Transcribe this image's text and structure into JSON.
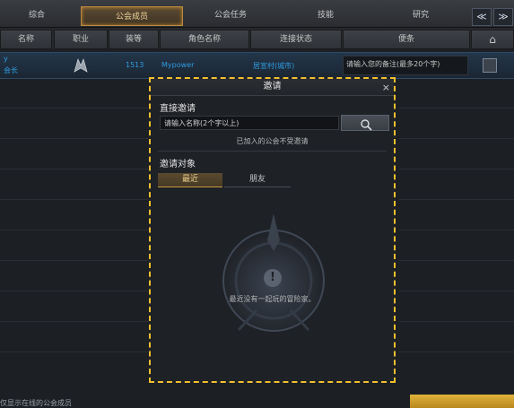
{
  "tabs": [
    {
      "label": "综合"
    },
    {
      "label": "公会成员",
      "active": true
    },
    {
      "label": "公会任务"
    },
    {
      "label": "技能"
    },
    {
      "label": "研究"
    }
  ],
  "nav": {
    "prev": "≪",
    "next": "≫"
  },
  "columns": [
    "名称",
    "职业",
    "装等",
    "角色名称",
    "连接状态",
    "便条"
  ],
  "member": {
    "rank": "会长",
    "item_level": "1513",
    "character": "Mypower",
    "status": "居宣村(城市)",
    "note_placeholder": "请输入您的备注(最多20个字)"
  },
  "dialog": {
    "title": "邀请",
    "close": "×",
    "direct_section": "直接邀请",
    "search_placeholder": "请输入名称(2个字以上)",
    "notice": "已加入的公会不受邀请",
    "target_section": "邀请对象",
    "subtabs": [
      "最近",
      "朋友"
    ],
    "empty_message": "最近没有一起玩的冒险家。"
  },
  "footer": {
    "note": "仅显示在线的公会成员"
  },
  "colors": {
    "accent_gold": "#f2c02e",
    "highlight_blue": "#2f9be0"
  }
}
